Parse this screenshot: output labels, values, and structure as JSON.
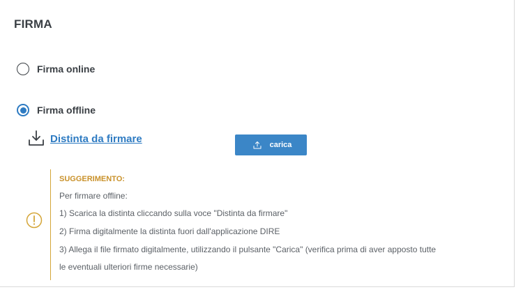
{
  "section": {
    "title": "FIRMA"
  },
  "signature_options": {
    "online_label": "Firma online",
    "offline_label": "Firma offline",
    "selected": "Firma offline"
  },
  "download": {
    "link_label": "Distinta da firmare",
    "icon": "download-icon"
  },
  "upload": {
    "button_label": "carica",
    "icon": "upload-icon"
  },
  "suggestion": {
    "icon": "warning-circle-icon",
    "title": "SUGGERIMENTO:",
    "intro": "Per firmare offline:",
    "step1": "1) Scarica la distinta cliccando sulla voce \"Distinta da firmare\"",
    "step2": "2) Firma digitalmente la distinta fuori dall'applicazione DIRE",
    "step3_part1": "3) Allega il file firmato digitalmente, utilizzando il pulsante \"Carica\" (verifica prima di aver apposto tutte",
    "step3_part2": "le eventuali ulteriori firme necessarie)"
  },
  "colors": {
    "accent": "#2e7bc2",
    "button": "#3b86c7",
    "warning": "#d4a537",
    "text": "#3a3f44"
  }
}
